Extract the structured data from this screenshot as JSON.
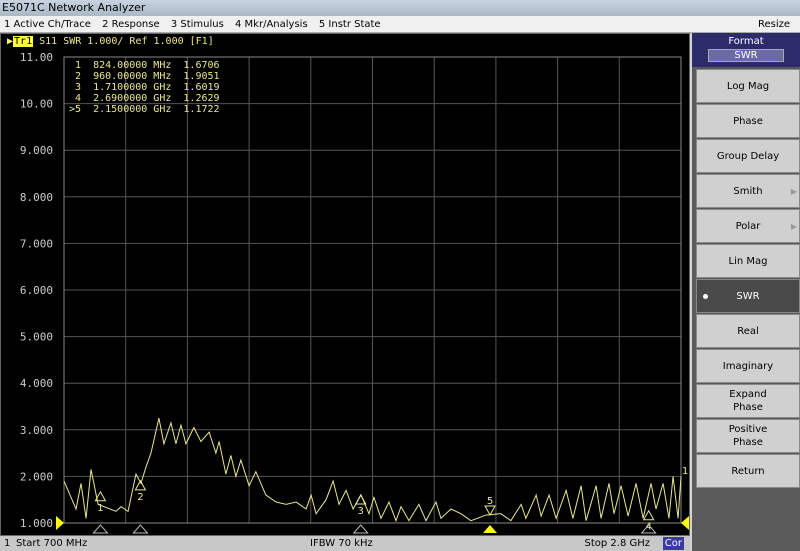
{
  "window": {
    "title": "E5071C Network Analyzer"
  },
  "menu": [
    {
      "label": "1 Active Ch/Trace"
    },
    {
      "label": "2 Response"
    },
    {
      "label": "3 Stimulus"
    },
    {
      "label": "4 Mkr/Analysis"
    },
    {
      "label": "5 Instr State"
    }
  ],
  "resize_label": "Resize",
  "trace": {
    "id": "Tr1",
    "info": "S11  SWR 1.000/ Ref 1.000 [F1]"
  },
  "markers": [
    {
      "label": "1",
      "freq": "824.00000 MHz",
      "value": "1.6706",
      "freq_mhz": 824,
      "swr": 1.6706
    },
    {
      "label": "2",
      "freq": "960.00000 MHz",
      "value": "1.9051",
      "freq_mhz": 960,
      "swr": 1.9051
    },
    {
      "label": "3",
      "freq": "1.7100000 GHz",
      "value": "1.6019",
      "freq_mhz": 1710,
      "swr": 1.6019
    },
    {
      "label": "4",
      "freq": "2.6900000 GHz",
      "value": "1.2629",
      "freq_mhz": 2690,
      "swr": 1.2629
    },
    {
      "label": ">5",
      "freq": "2.1500000 GHz",
      "value": "1.1722",
      "freq_mhz": 2150,
      "swr": 1.1722,
      "active": true
    }
  ],
  "chart_data": {
    "type": "line",
    "x_unit": "MHz",
    "xlim": [
      700,
      2800
    ],
    "ylim": [
      1,
      11
    ],
    "yticks": [
      "11.00",
      "10.00",
      "9.000",
      "8.000",
      "7.000",
      "6.000",
      "5.000",
      "4.000",
      "3.000",
      "2.000",
      "1.000"
    ],
    "grid": true,
    "trace_color": "#e8e890",
    "x": [
      700,
      741,
      758,
      775,
      792,
      816,
      877,
      894,
      918,
      945,
      962,
      979,
      996,
      1023,
      1040,
      1064,
      1081,
      1098,
      1115,
      1142,
      1166,
      1194,
      1217,
      1228,
      1251,
      1268,
      1285,
      1302,
      1330,
      1353,
      1387,
      1422,
      1456,
      1490,
      1524,
      1541,
      1558,
      1592,
      1616,
      1636,
      1660,
      1684,
      1711,
      1738,
      1755,
      1779,
      1806,
      1830,
      1847,
      1874,
      1908,
      1932,
      1966,
      1983,
      2017,
      2051,
      2085,
      2136,
      2187,
      2221,
      2256,
      2272,
      2307,
      2324,
      2351,
      2375,
      2409,
      2432,
      2460,
      2477,
      2511,
      2528,
      2555,
      2572,
      2596,
      2620,
      2647,
      2671,
      2698,
      2715,
      2739,
      2759,
      2773,
      2790,
      2800
    ],
    "y": [
      1.9,
      1.3,
      1.85,
      1.1,
      2.15,
      1.4,
      1.25,
      1.35,
      1.25,
      2.05,
      1.85,
      2.2,
      2.5,
      3.25,
      2.7,
      3.15,
      2.7,
      3.1,
      2.7,
      3.05,
      2.75,
      2.95,
      2.5,
      2.75,
      2.05,
      2.45,
      2.0,
      2.35,
      1.8,
      2.1,
      1.6,
      1.45,
      1.4,
      1.45,
      1.3,
      1.6,
      1.2,
      1.5,
      1.9,
      1.4,
      1.7,
      1.3,
      1.6,
      1.2,
      1.55,
      1.1,
      1.45,
      1.05,
      1.35,
      1.05,
      1.4,
      1.05,
      1.45,
      1.1,
      1.3,
      1.2,
      1.05,
      1.17,
      1.2,
      1.05,
      1.4,
      1.1,
      1.6,
      1.15,
      1.6,
      1.1,
      1.7,
      1.1,
      1.8,
      1.05,
      1.8,
      1.1,
      1.85,
      1.2,
      1.8,
      1.15,
      1.85,
      1.1,
      1.85,
      1.3,
      1.85,
      1.1,
      2.0,
      1.1,
      2.0
    ]
  },
  "status": {
    "channel": "1",
    "start": "Start 700 MHz",
    "ifbw": "IFBW 70 kHz",
    "stop": "Stop 2.8 GHz",
    "cor": "Cor"
  },
  "panel": {
    "title": "Format",
    "value": "SWR",
    "buttons": [
      {
        "label": "Log Mag"
      },
      {
        "label": "Phase"
      },
      {
        "label": "Group Delay"
      },
      {
        "label": "Smith",
        "submenu": true
      },
      {
        "label": "Polar",
        "submenu": true
      },
      {
        "label": "Lin Mag"
      },
      {
        "label": "SWR",
        "selected": true
      },
      {
        "label": "Real"
      },
      {
        "label": "Imaginary"
      },
      {
        "label": "Expand Phase"
      },
      {
        "label": "Positive Phase"
      },
      {
        "label": "Return"
      }
    ]
  }
}
